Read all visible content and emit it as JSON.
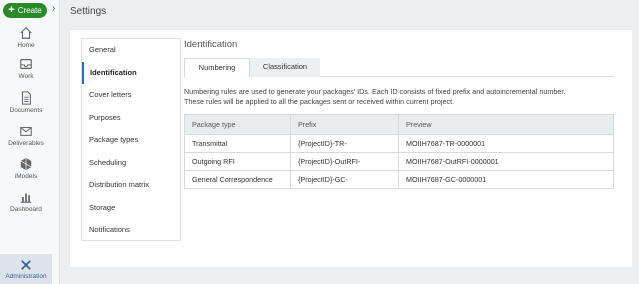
{
  "rail": {
    "create_label": "Create",
    "items": [
      {
        "label": "Home",
        "icon": "home-icon"
      },
      {
        "label": "Work",
        "icon": "inbox-icon"
      },
      {
        "label": "Documents",
        "icon": "document-icon"
      },
      {
        "label": "Deliverables",
        "icon": "envelope-icon"
      },
      {
        "label": "iModels",
        "icon": "imodel-icon"
      },
      {
        "label": "Dashboard",
        "icon": "chart-icon"
      }
    ],
    "admin_label": "Administration"
  },
  "page": {
    "title": "Settings"
  },
  "submenu": [
    {
      "label": "General"
    },
    {
      "label": "Identification",
      "active": true
    },
    {
      "label": "Cover letters"
    },
    {
      "label": "Purposes"
    },
    {
      "label": "Package types"
    },
    {
      "label": "Scheduling"
    },
    {
      "label": "Distribution matrix"
    },
    {
      "label": "Storage"
    },
    {
      "label": "Notifications"
    }
  ],
  "section": {
    "title": "Identification",
    "tabs": [
      {
        "label": "Numbering",
        "active": true
      },
      {
        "label": "Classification",
        "active": false
      }
    ],
    "desc_line1": "Numbering rules are used to generate your packages' IDs. Each ID consists of fixed prefix and autoincremental number.",
    "desc_line2": "These rules will be applied to all the packages sent or received within current project."
  },
  "table": {
    "headers": [
      "Package type",
      "Prefix",
      "Preview"
    ],
    "rows": [
      [
        "Transmittal",
        "{ProjectID}-TR-",
        "MOIIH7687-TR-0000001"
      ],
      [
        "Outgoing RFI",
        "{ProjectID}-OutRFI-",
        "MOIIH7687-OutRFI-0000001"
      ],
      [
        "General Correspondence",
        "{ProjectID}-GC-",
        "MOIIH7687-GC-0000001"
      ]
    ]
  }
}
